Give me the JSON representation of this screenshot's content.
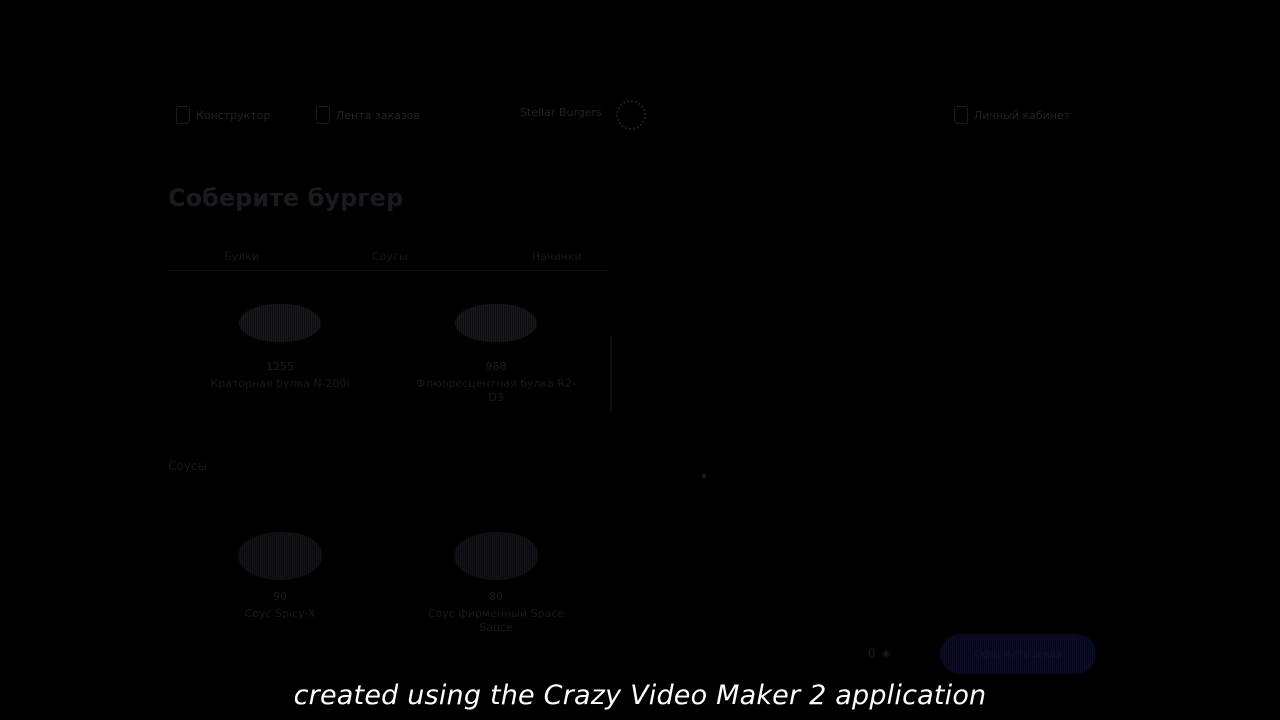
{
  "header": {
    "nav": [
      {
        "label": "Конструктор",
        "icon": "burger-icon"
      },
      {
        "label": "Лента заказов",
        "icon": "list-icon"
      }
    ],
    "logo_text": "Stellar Burgers",
    "account": {
      "label": "Личный кабинет",
      "icon": "profile-icon"
    }
  },
  "title": "Соберите бургер",
  "tabs": [
    "Булки",
    "Соусы",
    "Начинки"
  ],
  "buns": [
    {
      "price": "1255",
      "name": "Краторная булка N-200i"
    },
    {
      "price": "988",
      "name": "Флюоресцентная булка R2-D3"
    }
  ],
  "sauce_section": "Соусы",
  "sauces": [
    {
      "price": "90",
      "name": "Соус Spicy-X"
    },
    {
      "price": "80",
      "name": "Соус фирменный Space Sauce"
    }
  ],
  "total": {
    "value": "0"
  },
  "order_button": "Оформить заказ",
  "caption": "created using the Crazy Video Maker 2 application",
  "colors": {
    "background": "#000000",
    "caption": "#ffffff",
    "accent": "#0c0c22"
  }
}
